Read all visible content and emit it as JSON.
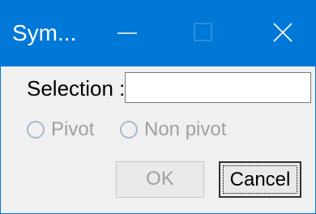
{
  "window": {
    "title": "Sym...",
    "controls": {
      "minimize_icon": "minimize-icon",
      "maximize_icon": "maximize-icon",
      "close_icon": "close-icon"
    },
    "colors": {
      "titlebar": "#0078d7",
      "background": "#f0f0f0"
    }
  },
  "form": {
    "selection_label": "Selection :",
    "selection_value": "",
    "radios": [
      {
        "label": "Pivot",
        "checked": false,
        "enabled": false
      },
      {
        "label": "Non pivot",
        "checked": false,
        "enabled": false
      }
    ]
  },
  "buttons": {
    "ok_label": "OK",
    "ok_enabled": false,
    "cancel_label": "Cancel"
  }
}
